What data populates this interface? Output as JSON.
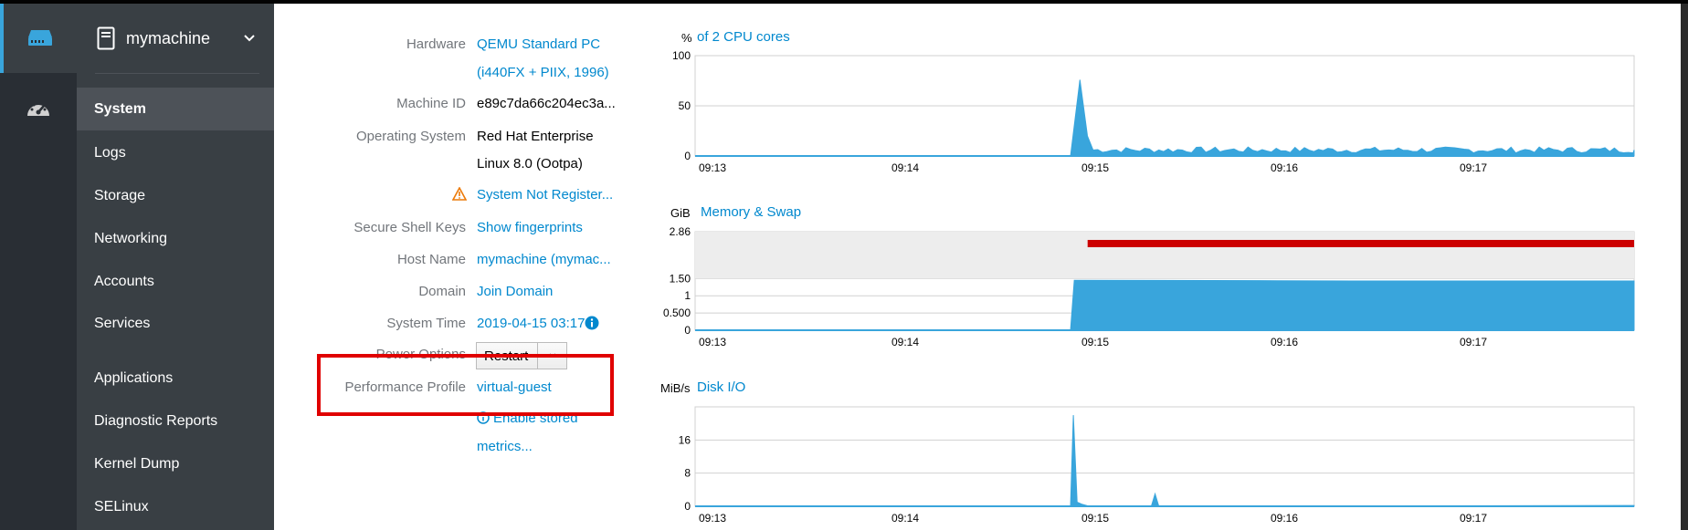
{
  "host": {
    "machine_name": "mymachine"
  },
  "nav": {
    "items": [
      "System",
      "Logs",
      "Storage",
      "Networking",
      "Accounts",
      "Services",
      "Applications",
      "Diagnostic Reports",
      "Kernel Dump",
      "SELinux"
    ]
  },
  "details": {
    "hardware_label": "Hardware",
    "hardware_value_1": "QEMU Standard PC",
    "hardware_value_2": "(i440FX + PIIX, 1996)",
    "machine_id_label": "Machine ID",
    "machine_id_value": "e89c7da66c204ec3a...",
    "os_label": "Operating System",
    "os_value_1": "Red Hat Enterprise",
    "os_value_2": "Linux 8.0 (Ootpa)",
    "registration_link": "System Not Register...",
    "ssh_label": "Secure Shell Keys",
    "ssh_link": "Show fingerprints",
    "hostname_label": "Host Name",
    "hostname_link": "mymachine (mymac...",
    "domain_label": "Domain",
    "domain_link": "Join Domain",
    "time_label": "System Time",
    "time_link": "2019-04-15 03:17",
    "power_label": "Power Options",
    "restart_label": "Restart",
    "profile_label": "Performance Profile",
    "profile_link": "virtual-guest",
    "metrics_link_1": "Enable stored",
    "metrics_link_2": "metrics..."
  },
  "charts": {
    "cpu": {
      "unit": "%",
      "title": "of 2 CPU cores"
    },
    "memory": {
      "unit": "GiB",
      "title": "Memory & Swap"
    },
    "disk": {
      "unit": "MiB/s",
      "title": "Disk I/O"
    }
  },
  "colors": {
    "accent": "#0088ce",
    "chart_fill": "#39a5dc",
    "swap": "#cc0000",
    "warning": "#ec7a08",
    "nav_bg": "#393f44",
    "host_bg": "#292e34"
  },
  "chart_data": [
    {
      "type": "area",
      "ylabel": "%",
      "title": "of 2 CPU cores",
      "ylim": [
        0,
        100
      ],
      "yticks": [
        "100",
        "50",
        "0"
      ],
      "xticks": [
        "09:13",
        "09:14",
        "09:15",
        "09:16",
        "09:17"
      ],
      "x": [
        0,
        2.0,
        2.08,
        2.1,
        2.2,
        2.5,
        3.0,
        3.5,
        4.0,
        4.5,
        5.0
      ],
      "values": [
        0,
        0,
        76,
        20,
        8,
        6,
        7,
        6,
        5,
        5,
        6
      ]
    },
    {
      "type": "area",
      "ylabel": "GiB",
      "title": "Memory & Swap",
      "ylim": [
        0,
        2.86
      ],
      "yticks": [
        "2.86",
        "1.50",
        "1",
        "0.500",
        "0"
      ],
      "xticks": [
        "09:13",
        "09:14",
        "09:15",
        "09:16",
        "09:17"
      ],
      "x": [
        0,
        2.0,
        2.03,
        2.5,
        3.0,
        3.5,
        4.0,
        4.5,
        5.0
      ],
      "series": [
        {
          "name": "",
          "values": [
            0,
            0,
            1.45,
            1.45,
            1.44,
            1.43,
            1.43,
            1.43,
            1.43
          ]
        }
      ],
      "swap_start": 2.03,
      "swap_value": 2.86
    },
    {
      "type": "area",
      "ylabel": "MiB/s",
      "title": "Disk I/O",
      "ylim": [
        0,
        24
      ],
      "yticks": [
        "16",
        "8",
        "0"
      ],
      "xticks": [
        "09:13",
        "09:14",
        "09:15",
        "09:16",
        "09:17"
      ],
      "x": [
        0,
        2.0,
        2.02,
        2.04,
        2.08,
        2.15,
        2.4,
        2.42,
        2.45,
        5.0
      ],
      "values": [
        0,
        0,
        22,
        1,
        0.5,
        0,
        0,
        3,
        0,
        0
      ]
    }
  ]
}
